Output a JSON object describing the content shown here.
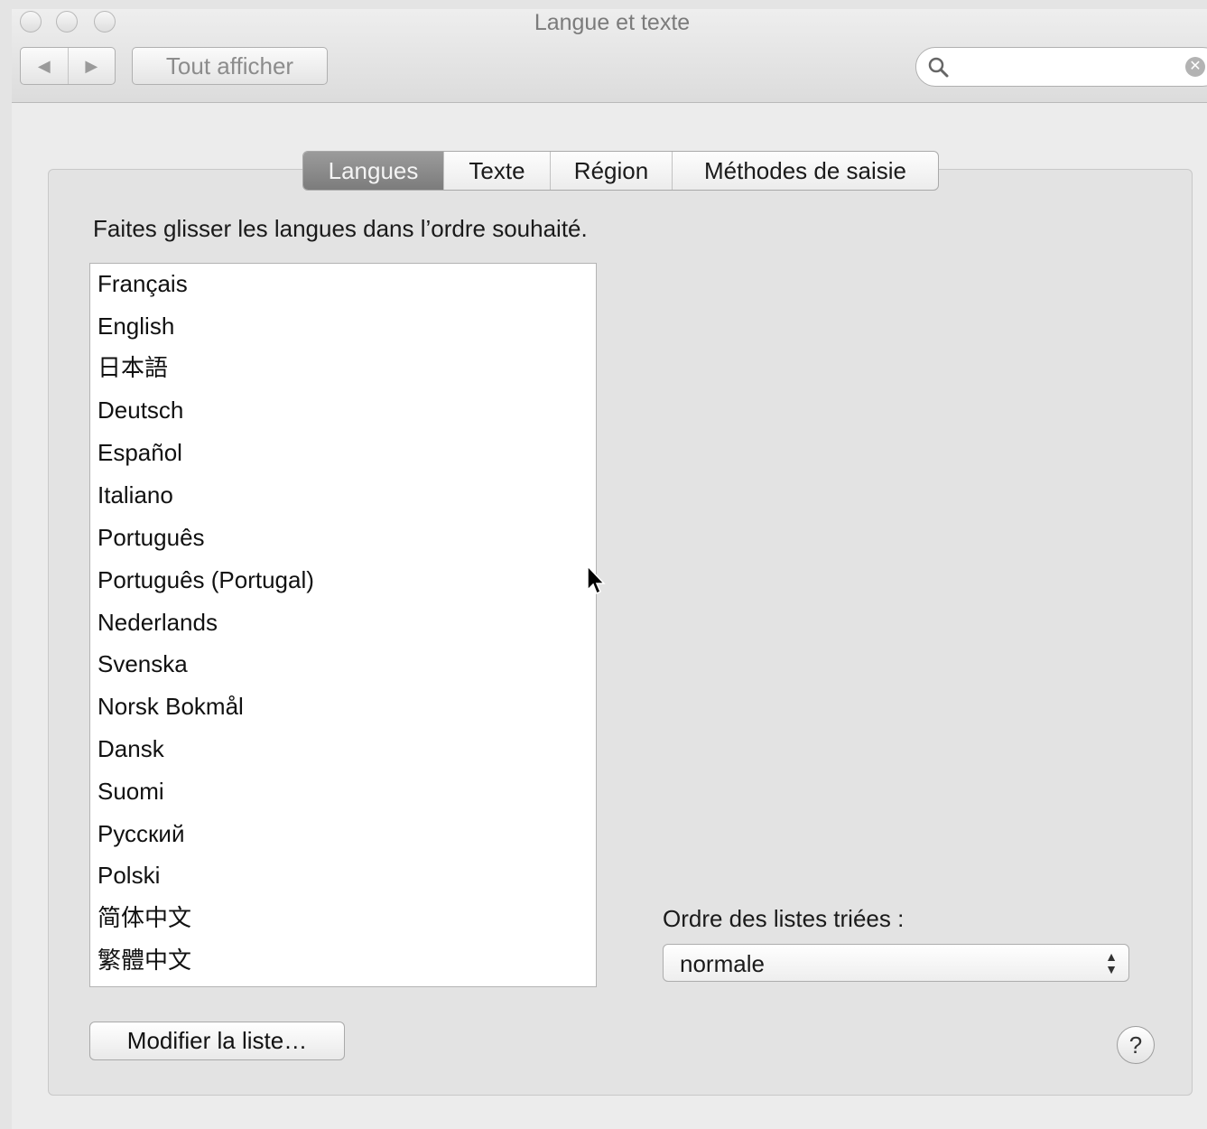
{
  "window": {
    "title": "Langue et texte"
  },
  "toolbar": {
    "back_icon": "back-arrow-icon",
    "forward_icon": "forward-arrow-icon",
    "show_all_label": "Tout afficher",
    "search": {
      "value": "",
      "placeholder": ""
    }
  },
  "tabs": [
    {
      "label": "Langues",
      "active": true
    },
    {
      "label": "Texte",
      "active": false
    },
    {
      "label": "Région",
      "active": false
    },
    {
      "label": "Méthodes de saisie",
      "active": false
    }
  ],
  "languages": {
    "instruction": "Faites glisser les langues dans l’ordre souhaité.",
    "items": [
      "Français",
      "English",
      "日本語",
      "Deutsch",
      "Español",
      "Italiano",
      "Português",
      "Português (Portugal)",
      "Nederlands",
      "Svenska",
      "Norsk Bokmål",
      "Dansk",
      "Suomi",
      "Русский",
      "Polski",
      "简体中文",
      "繁體中文"
    ],
    "edit_button": "Modifier la liste…"
  },
  "sort": {
    "label": "Ordre des listes triées :",
    "value": "normale"
  },
  "help_label": "?"
}
